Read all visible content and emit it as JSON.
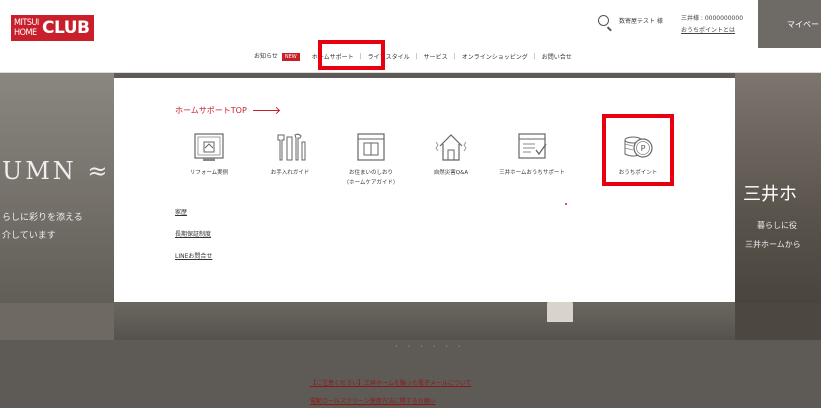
{
  "header": {
    "logo_mitsui": "MITSUI\nHOME",
    "logo_club": "CLUB",
    "user_name": "数寄屋テスト 様",
    "member_id": "三井様 : 0000000000",
    "points_link": "おうちポイントとは",
    "mypage_label": "マイペー"
  },
  "nav": {
    "items": [
      {
        "label": "お知らせ"
      },
      {
        "label": "ホームサポート"
      },
      {
        "label": "ライフスタイル"
      },
      {
        "label": "サービス"
      },
      {
        "label": "オンラインショッピング"
      },
      {
        "label": "お問い合せ"
      }
    ],
    "new_badge": "NEW",
    "separator": "|"
  },
  "megamenu": {
    "title": "ホームサポートTOP",
    "tiles": [
      {
        "label": "リフォーム実例",
        "icon": "renovation-icon"
      },
      {
        "label": "お手入れガイド",
        "icon": "tools-icon"
      },
      {
        "label": "お住まいのしおり",
        "label2": "（ホームケアガイド）",
        "icon": "guidebook-icon"
      },
      {
        "label": "自然災害Q&A",
        "icon": "house-disaster-icon"
      },
      {
        "label": "三井ホームおうちサポート",
        "icon": "support-checklist-icon"
      },
      {
        "label": "おうちポイント",
        "icon": "points-coin-icon"
      }
    ],
    "links": [
      {
        "label": "家歴"
      },
      {
        "label": "長期保証制度"
      },
      {
        "label": "LINEお問合せ"
      }
    ]
  },
  "hero": {
    "left_title": "UMN ≈",
    "left_line1": "らしに彩りを添える",
    "left_line2": "介しています",
    "right_title": "三井ホ",
    "right_line1": "暮らしに役",
    "right_line2": "三井ホームから"
  },
  "slider_dots": "• • • • • •",
  "news": [
    {
      "label": "【ご注意ください】三井ホームを騙った電子メールについて"
    },
    {
      "label": "電動ロールスクリーン使用方法に関するお願い"
    }
  ],
  "colors": {
    "brand_red": "#c81f2b",
    "highlight_red": "#e8000f",
    "overlay": "#5e5b57"
  }
}
